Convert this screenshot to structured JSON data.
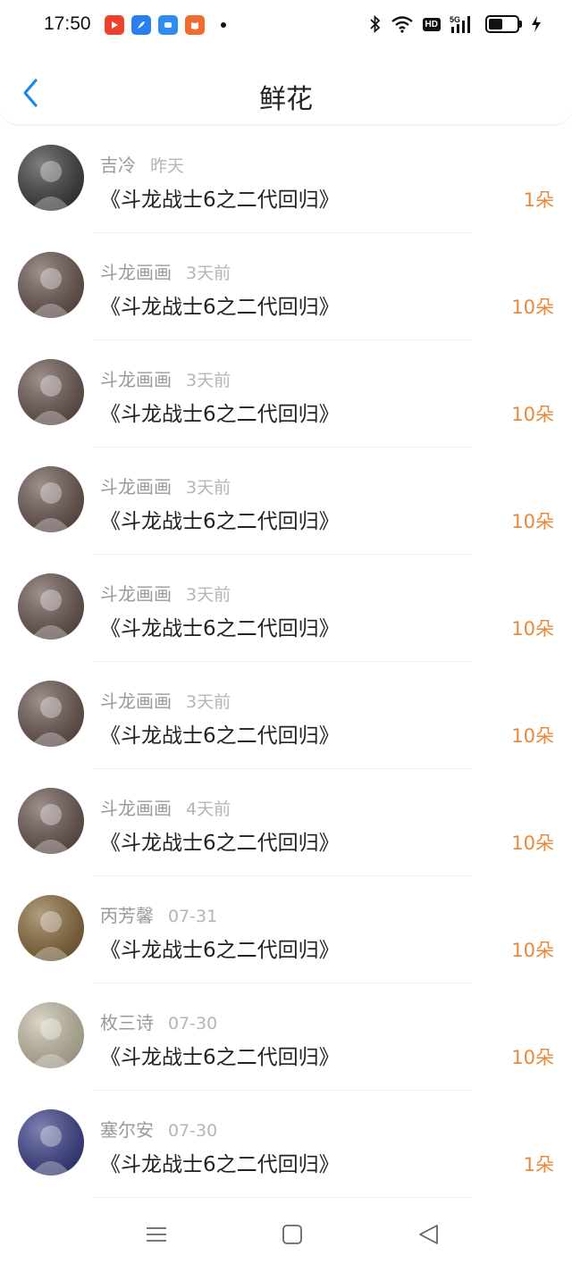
{
  "status_bar": {
    "time": "17:50",
    "app_icons": [
      {
        "name": "video-app-icon",
        "color": "#f0402e"
      },
      {
        "name": "feather-app-icon",
        "color": "#2a7ef0"
      },
      {
        "name": "chat-app-icon",
        "color": "#2f8cf5"
      },
      {
        "name": "reader-app-icon",
        "color": "#f26a2e"
      }
    ],
    "hd_badge": "HD",
    "network": "5G",
    "battery_level": 0.45
  },
  "header": {
    "title": "鲜花"
  },
  "list": {
    "items": [
      {
        "user": "吉冷",
        "time": "昨天",
        "book": "《斗龙战士6之二代回归》",
        "count": "1朵",
        "avatar_color": "#3b3b3b"
      },
      {
        "user": "斗龙画画",
        "time": "3天前",
        "book": "《斗龙战士6之二代回归》",
        "count": "10朵",
        "avatar_color": "#6b5550"
      },
      {
        "user": "斗龙画画",
        "time": "3天前",
        "book": "《斗龙战士6之二代回归》",
        "count": "10朵",
        "avatar_color": "#6b5550"
      },
      {
        "user": "斗龙画画",
        "time": "3天前",
        "book": "《斗龙战士6之二代回归》",
        "count": "10朵",
        "avatar_color": "#6b5550"
      },
      {
        "user": "斗龙画画",
        "time": "3天前",
        "book": "《斗龙战士6之二代回归》",
        "count": "10朵",
        "avatar_color": "#6b5550"
      },
      {
        "user": "斗龙画画",
        "time": "3天前",
        "book": "《斗龙战士6之二代回归》",
        "count": "10朵",
        "avatar_color": "#6b5550"
      },
      {
        "user": "斗龙画画",
        "time": "4天前",
        "book": "《斗龙战士6之二代回归》",
        "count": "10朵",
        "avatar_color": "#6b5550"
      },
      {
        "user": "丙芳馨",
        "time": "07-31",
        "book": "《斗龙战士6之二代回归》",
        "count": "10朵",
        "avatar_color": "#8a6a3a"
      },
      {
        "user": "枚三诗",
        "time": "07-30",
        "book": "《斗龙战士6之二代回归》",
        "count": "10朵",
        "avatar_color": "#c8c0a8"
      },
      {
        "user": "塞尔安",
        "time": "07-30",
        "book": "《斗龙战士6之二代回归》",
        "count": "1朵",
        "avatar_color": "#3a3f8a"
      }
    ]
  },
  "colors": {
    "accent": "#1e88e5",
    "flower_count": "#e8893c",
    "secondary_text": "#999999"
  }
}
